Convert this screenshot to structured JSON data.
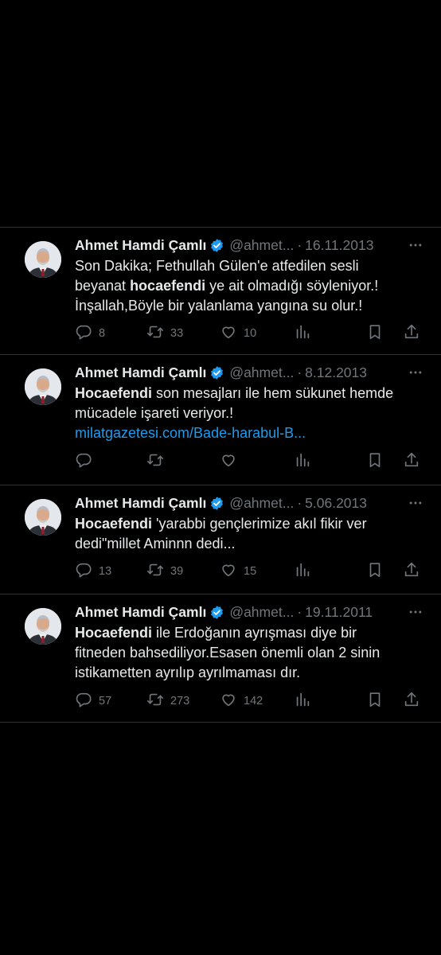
{
  "author": {
    "name": "Ahmet Hamdi Çamlı",
    "handle": "@ahmet...",
    "verified_color": "#1d9bf0"
  },
  "tweets": [
    {
      "date": "16.11.2013",
      "lines": [
        {
          "pre": "Son Dakika; Fethullah Gülen'e atfedilen sesli",
          "bold": "",
          "post": ""
        },
        {
          "pre": "beyanat ",
          "bold": "hocaefendi",
          "post": " ye ait olmadığı söyleniyor.!"
        },
        {
          "pre": "İnşallah,Böyle bir yalanlama yangına su olur.!",
          "bold": "",
          "post": ""
        }
      ],
      "link": "",
      "replies": "8",
      "retweets": "33",
      "likes": "10"
    },
    {
      "date": "8.12.2013",
      "lines": [
        {
          "pre": "",
          "bold": "Hocaefendi",
          "post": " son mesajları ile hem sükunet hemde"
        },
        {
          "pre": "mücadele işareti veriyor.!",
          "bold": "",
          "post": ""
        }
      ],
      "link": "milatgazetesi.com/Bade-harabul-B...",
      "replies": "",
      "retweets": "",
      "likes": ""
    },
    {
      "date": "5.06.2013",
      "lines": [
        {
          "pre": "",
          "bold": "Hocaefendi",
          "post": " 'yarabbi gençlerimize akıl fikir ver"
        },
        {
          "pre": "dedi\"millet Aminnn dedi...",
          "bold": "",
          "post": ""
        }
      ],
      "link": "",
      "replies": "13",
      "retweets": "39",
      "likes": "15"
    },
    {
      "date": "19.11.2011",
      "lines": [
        {
          "pre": "",
          "bold": "Hocaefendi",
          "post": " ile Erdoğanın ayrışması diye bir"
        },
        {
          "pre": "fitneden bahsediliyor.Esasen önemli olan 2 sinin",
          "bold": "",
          "post": ""
        },
        {
          "pre": "istikametten ayrılıp ayrılmaması dır.",
          "bold": "",
          "post": ""
        }
      ],
      "link": "",
      "replies": "57",
      "retweets": "273",
      "likes": "142"
    }
  ],
  "icons": [
    "reply-icon",
    "retweet-icon",
    "like-icon",
    "views-icon",
    "bookmark-icon",
    "share-icon",
    "more-icon",
    "verified-badge-icon"
  ]
}
